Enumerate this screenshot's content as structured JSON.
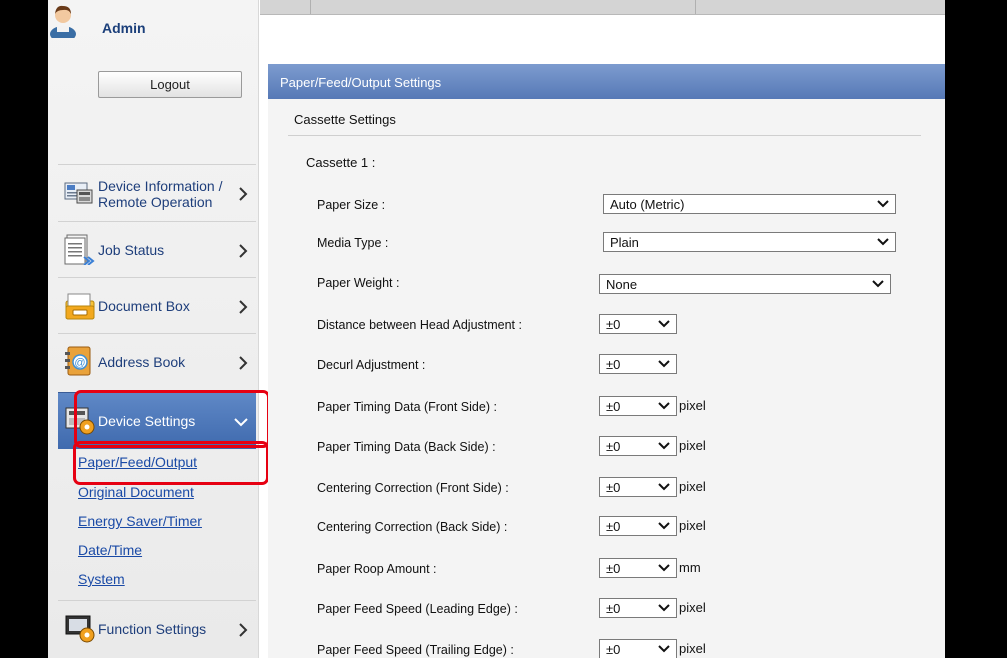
{
  "sidebar": {
    "admin_name": "Admin",
    "logout_label": "Logout",
    "nav": {
      "device_info_line1": "Device Information /",
      "device_info_line2": "Remote Operation",
      "job_status": "Job Status",
      "document_box": "Document Box",
      "address_book": "Address Book",
      "device_settings": "Device Settings",
      "function_settings": "Function Settings"
    },
    "sub_items": [
      "Paper/Feed/Output",
      "Original Document",
      "Energy Saver/Timer",
      "Date/Time",
      "System"
    ]
  },
  "content": {
    "header": "Paper/Feed/Output Settings",
    "section_title": "Cassette Settings",
    "group_title": "Cassette 1 :",
    "rows": [
      {
        "label": "Paper Size :",
        "value": "Auto (Metric)",
        "unit": ""
      },
      {
        "label": "Media Type :",
        "value": "Plain",
        "unit": ""
      },
      {
        "label": "Paper Weight :",
        "value": "None",
        "unit": ""
      },
      {
        "label": "Distance between Head Adjustment :",
        "value": "±0",
        "unit": ""
      },
      {
        "label": "Decurl Adjustment :",
        "value": "±0",
        "unit": ""
      },
      {
        "label": "Paper Timing Data (Front Side) :",
        "value": "±0",
        "unit": "pixel"
      },
      {
        "label": "Paper Timing Data (Back Side) :",
        "value": "±0",
        "unit": "pixel"
      },
      {
        "label": "Centering Correction (Front Side) :",
        "value": "±0",
        "unit": "pixel"
      },
      {
        "label": "Centering Correction (Back Side) :",
        "value": "±0",
        "unit": "pixel"
      },
      {
        "label": "Paper Roop Amount :",
        "value": "±0",
        "unit": "mm"
      },
      {
        "label": "Paper Feed Speed (Leading Edge) :",
        "value": "±0",
        "unit": "pixel"
      },
      {
        "label": "Paper Feed Speed (Trailing Edge) :",
        "value": "±0",
        "unit": "pixel"
      }
    ]
  },
  "colors": {
    "accent_blue": "#4f78bb",
    "highlight_red": "#e60012",
    "link_blue": "#1a4aa6"
  },
  "icons": [
    "user-avatar-icon",
    "device-info-icon",
    "job-status-icon",
    "document-box-icon",
    "address-book-icon",
    "device-settings-icon",
    "function-settings-icon",
    "chevron-right-icon",
    "chevron-down-icon"
  ]
}
